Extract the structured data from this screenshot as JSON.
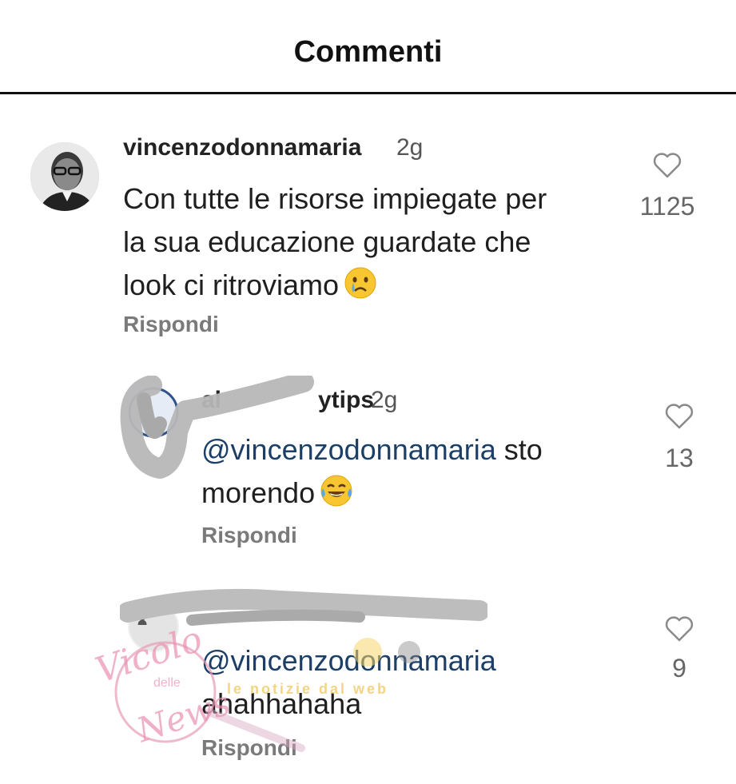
{
  "header": {
    "title": "Commenti"
  },
  "comments": [
    {
      "username": "vincenzodonnamaria",
      "time": "2g",
      "line1": "Con tutte le risorse impiegate per",
      "line2": "la sua educazione guardate che",
      "line3": "look ci ritroviamo",
      "emoji": "crying-face",
      "likes": "1125",
      "reply_label": "Rispondi"
    },
    {
      "username_visible": "al",
      "username_tail": "ytips",
      "time": "2g",
      "mention": "@vincenzodonnamaria",
      "after_mention": " sto",
      "line2": "morendo",
      "emoji": "tears-of-joy-face",
      "likes": "13",
      "reply_label": "Rispondi"
    },
    {
      "mention": "@vincenzodonnamaria",
      "line2": "ahahhahaha",
      "likes": "9",
      "reply_label": "Rispondi"
    }
  ],
  "watermark": {
    "text1": "Vicolo",
    "text2": "delle",
    "text3": "News",
    "tagline": "le notizie dal web"
  }
}
